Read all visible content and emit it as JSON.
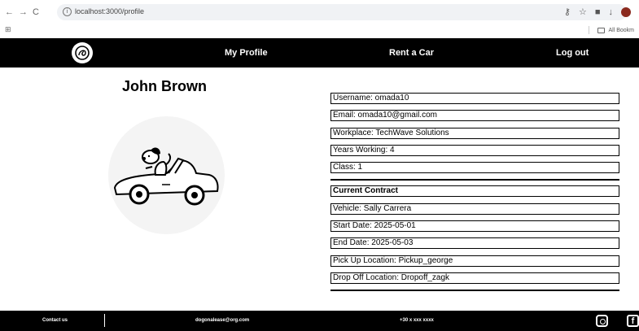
{
  "browser": {
    "url": "localhost:3000/profile",
    "back_glyph": "←",
    "forward_glyph": "→",
    "reload_glyph": "C",
    "bookmarks_label": "All Bookm",
    "apps_glyph": "⊞"
  },
  "header": {
    "nav": [
      {
        "label": "My Profile"
      },
      {
        "label": "Rent a Car"
      },
      {
        "label": "Log out"
      }
    ]
  },
  "profile": {
    "name": "John Brown",
    "fields": [
      "Username: omada10",
      "Email: omada10@gmail.com",
      "Workplace: TechWave Solutions",
      "Years Working: 4",
      "Class: 1"
    ]
  },
  "contract": {
    "heading": "Current Contract",
    "fields": [
      "Vehicle: Sally Carrera",
      "Start Date: 2025-05-01",
      "End Date: 2025-05-03",
      "Pick Up Location: Pickup_george",
      "Drop Off Location: Dropoff_zagk"
    ]
  },
  "footer": {
    "contact": "Contact us",
    "email": "dogonalease@org.com",
    "phone": "+30 x xxx xxxx",
    "facebook_glyph": "f"
  }
}
